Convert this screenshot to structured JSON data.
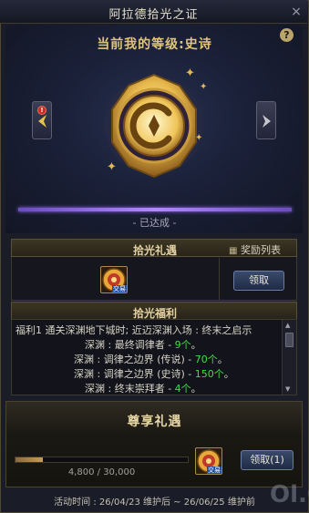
{
  "window": {
    "title": "阿拉德拾光之证",
    "close": "×"
  },
  "hero": {
    "help": "?",
    "level_text": "当前我的等级:史诗",
    "status": "- 已达成 -",
    "alert_badge": "!",
    "progress": 1.0,
    "accent_color": "#b388ff"
  },
  "reward": {
    "header": "拾光礼遇",
    "list_button": "奖励列表",
    "item_tag": "交易",
    "claim_button": "领取"
  },
  "welfare": {
    "header": "拾光福利",
    "lines": [
      {
        "label": "福利1 通关深渊地下城时; 近迈深渊入场 : 终末之启示",
        "value": ""
      },
      {
        "label": "深渊 : 最终调律者 - ",
        "value": "9个"
      },
      {
        "label": "深渊 : 调律之边界 (传说) - ",
        "value": "70个"
      },
      {
        "label": "深渊 : 调律之边界 (史诗) - ",
        "value": "150个"
      },
      {
        "label": "深渊 : 终末崇拜者 - ",
        "value": "4个"
      }
    ],
    "value_color": "#3fdc4a"
  },
  "premium": {
    "title": "尊享礼遇",
    "current": "4,800",
    "total": "30,000",
    "separator": " / ",
    "fraction": 0.16,
    "item_tag": "交易",
    "claim_button": "领取(1)"
  },
  "footer": "活动时间 : 26/04/23 维护后 ~ 26/06/25 维护前",
  "watermark": "Ol.G"
}
